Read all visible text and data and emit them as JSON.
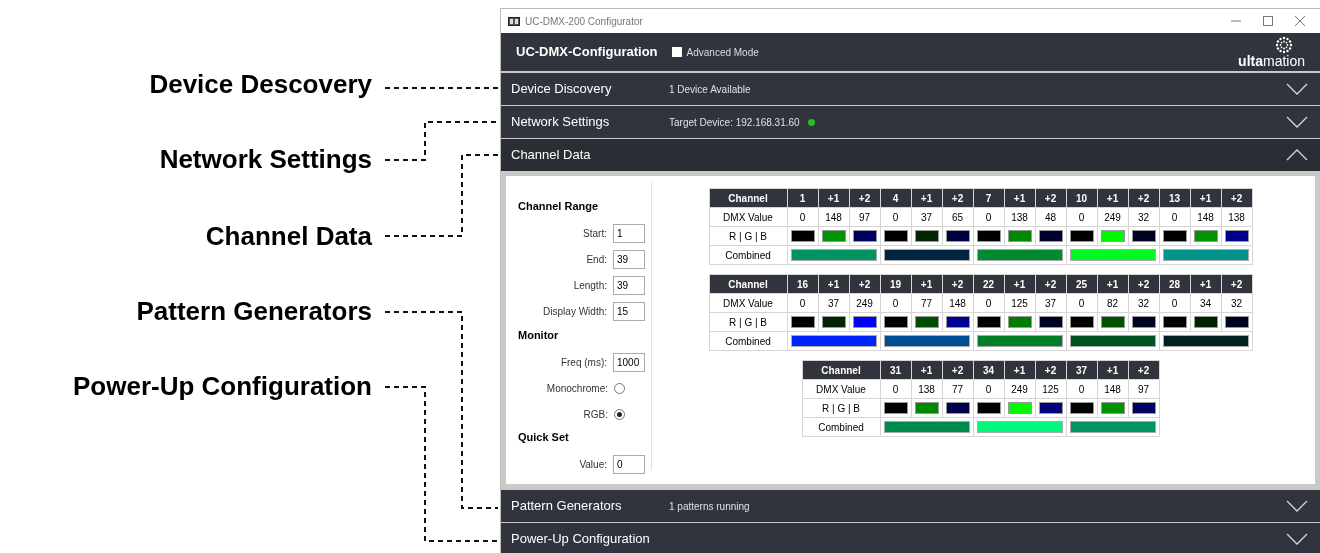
{
  "annotations": [
    {
      "label": "Device Descovery"
    },
    {
      "label": "Network Settings"
    },
    {
      "label": "Channel Data"
    },
    {
      "label": "Pattern Generators"
    },
    {
      "label": "Power-Up Configuration"
    }
  ],
  "window": {
    "title": "UC-DMX-200 Configurator"
  },
  "header": {
    "title": "UC-DMX-Configuration",
    "advanced_mode": {
      "label": "Advanced Mode",
      "checked": false
    },
    "logo": "**ulta**mation"
  },
  "sections": [
    {
      "title": "Device Discovery",
      "status": "1 Device Available",
      "expanded": false
    },
    {
      "title": "Network Settings",
      "status": "Target Device: 192.168.31.60",
      "status_dot": {
        "color": "#22c022"
      },
      "expanded": false
    },
    {
      "title": "Channel Data",
      "expanded": true
    },
    {
      "title": "Pattern Generators",
      "status": "1 patterns running",
      "expanded": false
    },
    {
      "title": "Power-Up Configuration",
      "expanded": false
    }
  ],
  "channel_panel": {
    "groups": [
      {
        "title": "Channel Range",
        "fields": [
          {
            "kind": "input",
            "label": "Start:",
            "value": "1"
          },
          {
            "kind": "input",
            "label": "End:",
            "value": "39"
          },
          {
            "kind": "input",
            "label": "Length:",
            "value": "39"
          },
          {
            "kind": "input",
            "label": "Display Width:",
            "value": "15"
          }
        ]
      },
      {
        "title": "Monitor",
        "fields": [
          {
            "kind": "input",
            "label": "Freq (ms):",
            "value": "1000"
          },
          {
            "kind": "radio",
            "label": "Monochrome:",
            "selected": false
          },
          {
            "kind": "radio",
            "label": "RGB:",
            "selected": true
          }
        ]
      },
      {
        "title": "Quick Set",
        "fields": [
          {
            "kind": "input",
            "label": "Value:",
            "value": "0"
          }
        ]
      }
    ]
  },
  "tables": [
    {
      "row_labels": [
        "Channel",
        "DMX Value",
        "R | G | B",
        "Combined"
      ],
      "columns": [
        "1",
        "+1",
        "+2",
        "4",
        "+1",
        "+2",
        "7",
        "+1",
        "+2",
        "10",
        "+1",
        "+2",
        "13",
        "+1",
        "+2"
      ],
      "values": [
        "0",
        "148",
        "97",
        "0",
        "37",
        "65",
        "0",
        "138",
        "48",
        "0",
        "249",
        "32",
        "0",
        "148",
        "138"
      ]
    },
    {
      "row_labels": [
        "Channel",
        "DMX Value",
        "R | G | B",
        "Combined"
      ],
      "columns": [
        "16",
        "+1",
        "+2",
        "19",
        "+1",
        "+2",
        "22",
        "+1",
        "+2",
        "25",
        "+1",
        "+2",
        "28",
        "+1",
        "+2"
      ],
      "values": [
        "0",
        "37",
        "249",
        "0",
        "77",
        "148",
        "0",
        "125",
        "37",
        "0",
        "82",
        "32",
        "0",
        "34",
        "32"
      ]
    },
    {
      "row_labels": [
        "Channel",
        "DMX Value",
        "R | G | B",
        "Combined"
      ],
      "columns": [
        "31",
        "+1",
        "+2",
        "34",
        "+1",
        "+2",
        "37",
        "+1",
        "+2"
      ],
      "values": [
        "0",
        "138",
        "77",
        "0",
        "249",
        "125",
        "0",
        "148",
        "97"
      ]
    }
  ]
}
